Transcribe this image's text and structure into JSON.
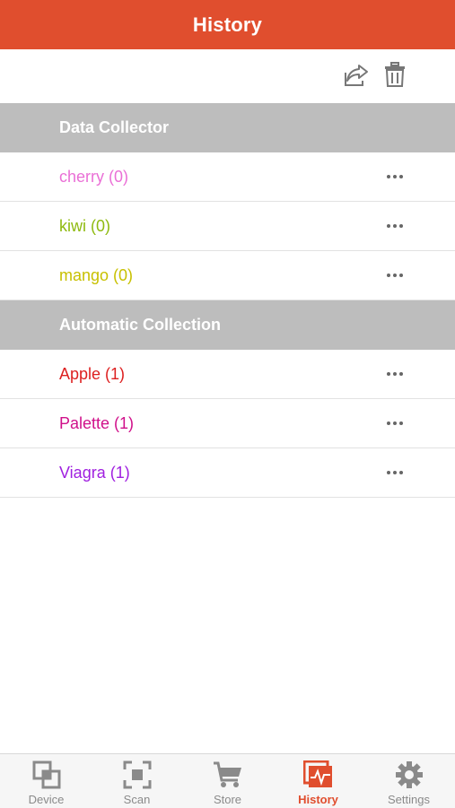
{
  "header": {
    "title": "History"
  },
  "toolbar": {
    "share_icon": "share-icon",
    "delete_icon": "trash-icon"
  },
  "sections": [
    {
      "title": "Data Collector",
      "items": [
        {
          "label": "cherry (0)",
          "color": "#ea6fd6"
        },
        {
          "label": "kiwi (0)",
          "color": "#8fba10"
        },
        {
          "label": "mango (0)",
          "color": "#c8c000"
        }
      ]
    },
    {
      "title": "Automatic Collection",
      "items": [
        {
          "label": "Apple (1)",
          "color": "#dd2020"
        },
        {
          "label": "Palette (1)",
          "color": "#d0108a"
        },
        {
          "label": "Viagra (1)",
          "color": "#a020e0"
        }
      ]
    }
  ],
  "tabbar": {
    "active": "History",
    "tabs": [
      {
        "label": "Device",
        "icon": "device-icon"
      },
      {
        "label": "Scan",
        "icon": "scan-icon"
      },
      {
        "label": "Store",
        "icon": "cart-icon"
      },
      {
        "label": "History",
        "icon": "history-icon"
      },
      {
        "label": "Settings",
        "icon": "gear-icon"
      }
    ]
  },
  "colors": {
    "accent": "#e04e2e",
    "section_bg": "#bdbdbd",
    "inactive": "#8a8a8a"
  }
}
